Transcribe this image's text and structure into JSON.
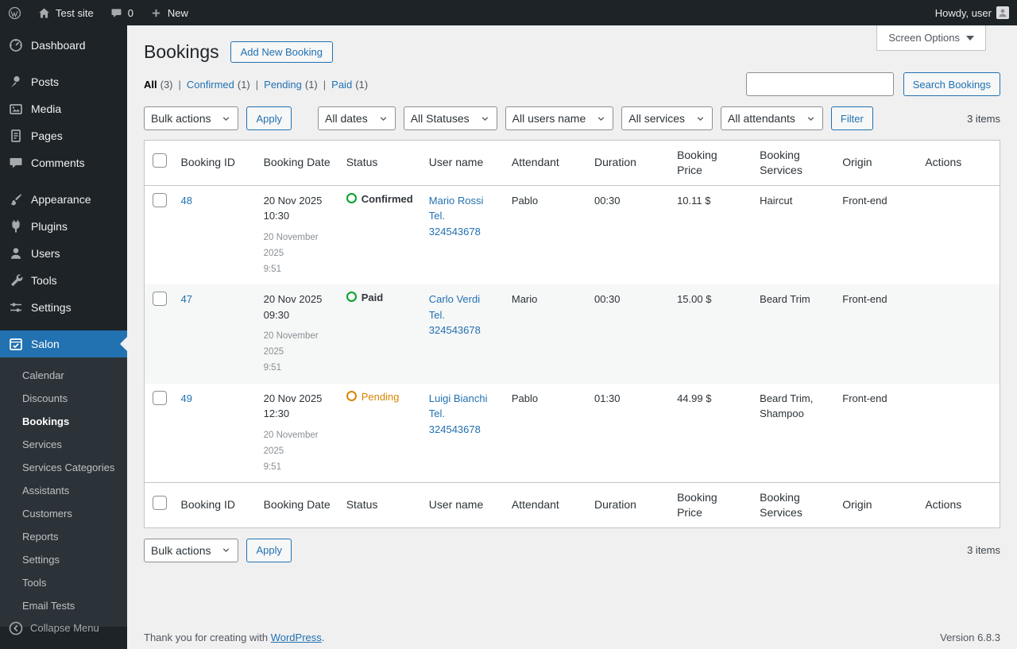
{
  "admin_bar": {
    "site_name": "Test site",
    "comments_count": "0",
    "new_label": "New",
    "howdy": "Howdy, user"
  },
  "sidebar": {
    "items": [
      {
        "label": "Dashboard"
      },
      {
        "label": "Posts"
      },
      {
        "label": "Media"
      },
      {
        "label": "Pages"
      },
      {
        "label": "Comments"
      },
      {
        "label": "Appearance"
      },
      {
        "label": "Plugins"
      },
      {
        "label": "Users"
      },
      {
        "label": "Tools"
      },
      {
        "label": "Settings"
      },
      {
        "label": "Salon"
      }
    ],
    "submenu": [
      {
        "label": "Calendar"
      },
      {
        "label": "Discounts"
      },
      {
        "label": "Bookings"
      },
      {
        "label": "Services"
      },
      {
        "label": "Services Categories"
      },
      {
        "label": "Assistants"
      },
      {
        "label": "Customers"
      },
      {
        "label": "Reports"
      },
      {
        "label": "Settings"
      },
      {
        "label": "Tools"
      },
      {
        "label": "Email Tests"
      }
    ],
    "collapse_label": "Collapse Menu"
  },
  "page": {
    "title": "Bookings",
    "add_new": "Add New Booking",
    "screen_options": "Screen Options"
  },
  "views": {
    "separator": "|",
    "all": {
      "label": "All",
      "count": "(3)"
    },
    "confirmed": {
      "label": "Confirmed",
      "count": "(1)"
    },
    "pending": {
      "label": "Pending",
      "count": "(1)"
    },
    "paid": {
      "label": "Paid",
      "count": "(1)"
    }
  },
  "search": {
    "value": "",
    "button_label": "Search Bookings"
  },
  "toolbar": {
    "bulk_actions": "Bulk actions",
    "apply": "Apply",
    "dates": "All dates",
    "statuses": "All Statuses",
    "users": "All users name",
    "services": "All services",
    "attendants": "All attendants",
    "filter": "Filter",
    "items_count": "3 items"
  },
  "table": {
    "headers": {
      "booking_id": "Booking ID",
      "booking_date": "Booking Date",
      "status": "Status",
      "user_name": "User name",
      "attendant": "Attendant",
      "duration": "Duration",
      "booking_price": "Booking Price",
      "booking_services": "Booking Services",
      "origin": "Origin",
      "actions": "Actions"
    },
    "rows": [
      {
        "id": "48",
        "date": "20 Nov 2025\n10:30",
        "date_detail": "20 November\n2025\n9:51",
        "status": "Confirmed",
        "user": "Mario Rossi\nTel.\n324543678",
        "attendant": "Pablo",
        "duration": "00:30",
        "price": "10.11 $",
        "services": "Haircut",
        "origin": "Front-end"
      },
      {
        "id": "47",
        "date": "20 Nov 2025\n09:30",
        "date_detail": "20 November\n2025\n9:51",
        "status": "Paid",
        "user": "Carlo Verdi\nTel.\n324543678",
        "attendant": "Mario",
        "duration": "00:30",
        "price": "15.00 $",
        "services": "Beard Trim",
        "origin": "Front-end"
      },
      {
        "id": "49",
        "date": "20 Nov 2025\n12:30",
        "date_detail": "20 November\n2025\n9:51",
        "status": "Pending",
        "user": "Luigi Bianchi\nTel.\n324543678",
        "attendant": "Pablo",
        "duration": "01:30",
        "price": "44.99 $",
        "services": "Beard Trim, Shampoo",
        "origin": "Front-end"
      }
    ]
  },
  "footer": {
    "thanks": "Thank you for creating with",
    "wordpress_link": "WordPress",
    "period": ".",
    "version": "Version 6.8.3"
  },
  "colors": {
    "accent": "#2271b1",
    "status_confirmed": "#00a32a",
    "status_paid": "#00a32a",
    "status_pending": "#d98500",
    "salon_icon": "#00c6d9",
    "admin_dark": "#1d2327"
  }
}
